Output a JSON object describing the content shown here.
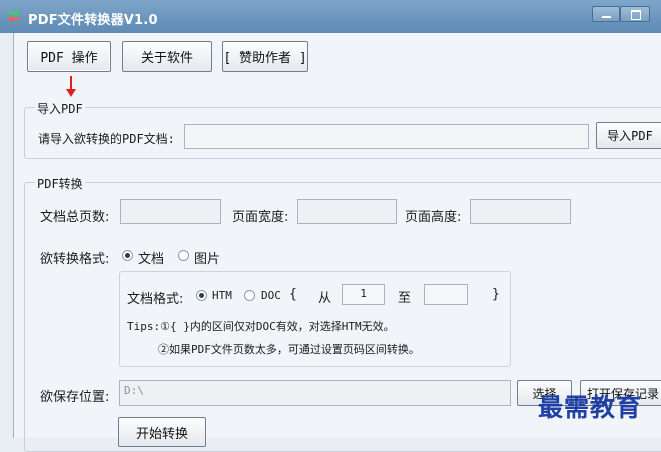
{
  "window": {
    "title": "PDF文件转换器V1.0"
  },
  "toolbar": {
    "pdf_ops": "PDF 操作",
    "about": "关于软件",
    "donate": "[ 赞助作者 ]"
  },
  "import_group": {
    "legend": "导入PDF",
    "prompt": "请导入欲转换的PDF文档:",
    "path_value": "",
    "import_button": "导入PDF"
  },
  "convert_group": {
    "legend": "PDF转换",
    "total_pages_label": "文档总页数:",
    "page_width_label": "页面宽度:",
    "page_height_label": "页面高度:",
    "format_label": "欲转换格式:",
    "format_options": [
      "文档",
      "图片"
    ],
    "format_selected": "文档",
    "doc_format_label": "文档格式:",
    "doc_format_options": [
      "HTM",
      "DOC"
    ],
    "doc_format_selected": "HTM",
    "range_open": "{",
    "range_from": "从",
    "range_start": "1",
    "range_to": "至",
    "range_end": "",
    "range_close": "}",
    "tip1": "Tips:①{ }内的区间仅对DOC有效，对选择HTM无效。",
    "tip2": "②如果PDF文件页数太多，可通过设置页码区间转换。",
    "save_label": "欲保存位置:",
    "save_path": "D:\\",
    "choose_button": "选择",
    "open_record_button": "打开保存记录",
    "start_button": "开始转换"
  },
  "watermark": "最需教育"
}
